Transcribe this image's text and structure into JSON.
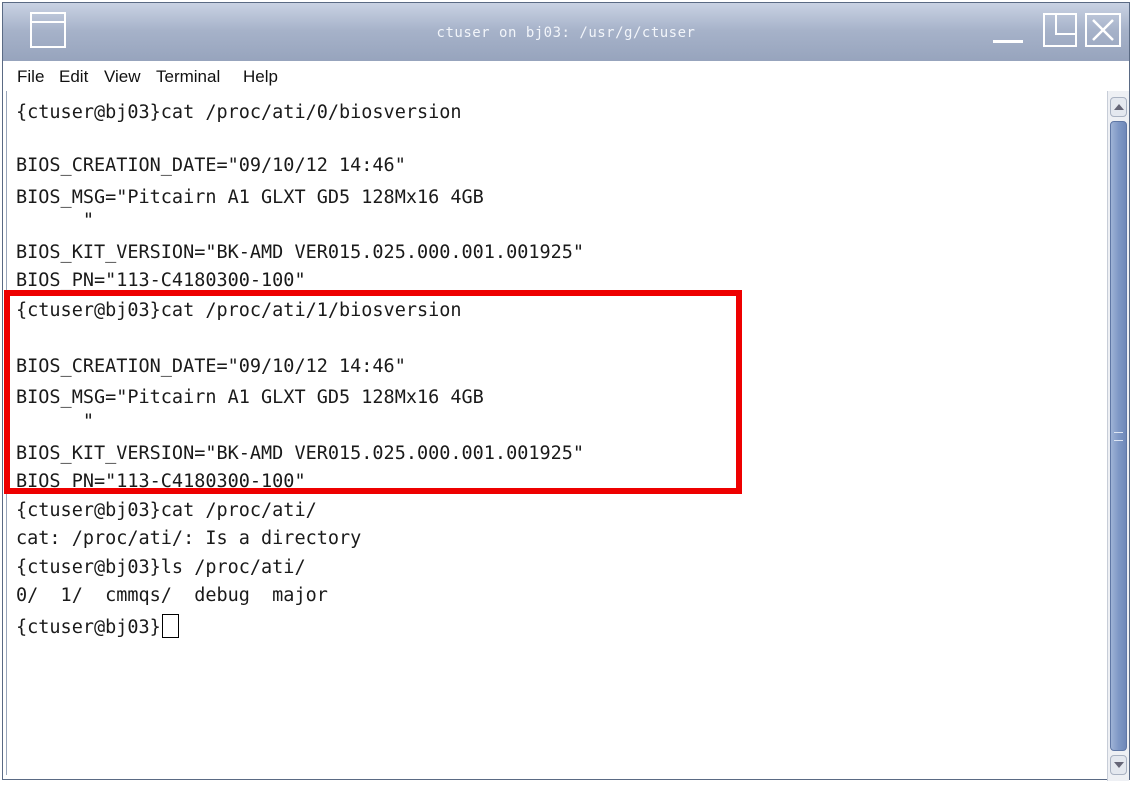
{
  "window": {
    "title": "ctuser on bj03: /usr/g/ctuser",
    "controls": {
      "menu_icon": "window-menu-icon",
      "minimize_icon": "minimize-icon",
      "maximize_icon": "maximize-icon",
      "close_icon": "close-icon"
    }
  },
  "menubar": {
    "items": [
      "File",
      "Edit",
      "View",
      "Terminal",
      "Help"
    ]
  },
  "terminal": {
    "lines": [
      "{ctuser@bj03}cat /proc/ati/0/biosversion",
      "",
      "BIOS_CREATION_DATE=\"09/10/12 14:46\"",
      "BIOS_MSG=\"Pitcairn A1 GLXT GD5 128Mx16 4GB",
      "      \"",
      "BIOS_KIT_VERSION=\"BK-AMD VER015.025.000.001.001925\"",
      "BIOS_PN=\"113-C4180300-100\"",
      "{ctuser@bj03}cat /proc/ati/1/biosversion",
      "",
      "BIOS_CREATION_DATE=\"09/10/12 14:46\"",
      "BIOS_MSG=\"Pitcairn A1 GLXT GD5 128Mx16 4GB",
      "      \"",
      "BIOS_KIT_VERSION=\"BK-AMD VER015.025.000.001.001925\"",
      "BIOS_PN=\"113-C4180300-100\"",
      "{ctuser@bj03}cat /proc/ati/",
      "cat: /proc/ati/: Is a directory",
      "{ctuser@bj03}ls /proc/ati/",
      "0/  1/  cmmqs/  debug  major",
      "{ctuser@bj03}"
    ],
    "annotation_color": "#ee0000"
  }
}
